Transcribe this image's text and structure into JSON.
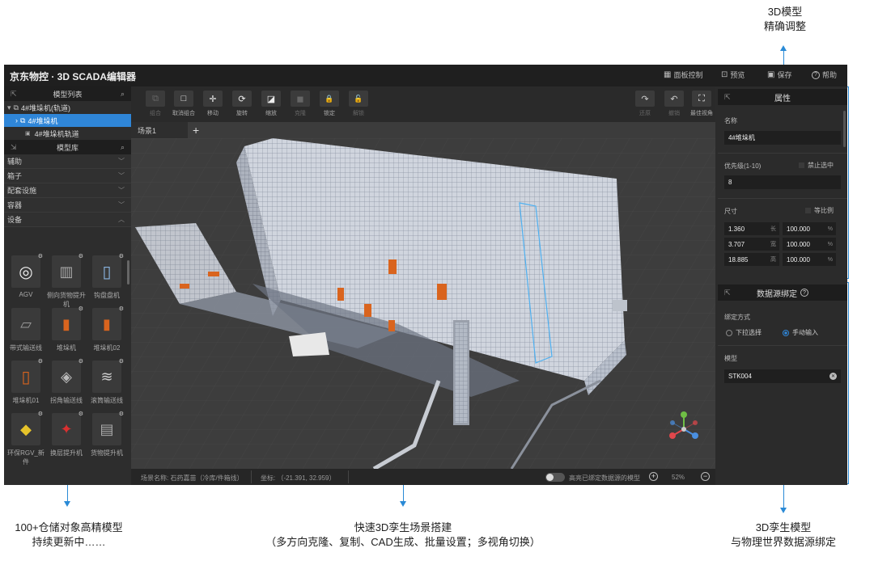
{
  "callouts": {
    "top_right_line1": "3D模型",
    "top_right_line2": "精确调整",
    "bottom_left_line1": "100+仓储对象高精模型",
    "bottom_left_line2": "持续更新中……",
    "bottom_center_line1": "快速3D孪生场景搭建",
    "bottom_center_line2": "（多方向克隆、复制、CAD生成、批量设置；多视角切换）",
    "bottom_right_line1": "3D孪生模型",
    "bottom_right_line2": "与物理世界数据源绑定"
  },
  "app": {
    "brand": "京东物控 · 3D SCADA编辑器",
    "top_menu": [
      {
        "icon": "panel-control-icon",
        "glyph": "▦",
        "label": "面板控制"
      },
      {
        "icon": "preview-icon",
        "glyph": "⊡",
        "label": "预览"
      },
      {
        "icon": "save-icon",
        "glyph": "▣",
        "label": "保存"
      },
      {
        "icon": "help-icon",
        "glyph": "?",
        "label": "帮助"
      }
    ]
  },
  "model_list": {
    "title": "模型列表",
    "tree": [
      {
        "label": "4#堆垛机(轨道)",
        "level": 0,
        "selected": false
      },
      {
        "label": "4#堆垛机",
        "level": 1,
        "selected": true
      },
      {
        "label": "4#堆垛机轨道",
        "level": 1,
        "selected": false
      }
    ]
  },
  "model_library": {
    "title": "模型库",
    "categories": [
      "辅助",
      "箱子",
      "配套设施",
      "容器",
      "设备"
    ],
    "items": [
      {
        "label": "AGV",
        "glyph": "◎"
      },
      {
        "label": "侧向货物提升机",
        "glyph": "▥"
      },
      {
        "label": "钩盘盘机",
        "glyph": "▯"
      },
      {
        "label": "带式输送线",
        "glyph": "▱"
      },
      {
        "label": "堆垛机",
        "glyph": "▮"
      },
      {
        "label": "堆垛机02",
        "glyph": "▮"
      },
      {
        "label": "堆垛机01",
        "glyph": "▯"
      },
      {
        "label": "拐角输送线",
        "glyph": "◈"
      },
      {
        "label": "滚筒输送线",
        "glyph": "≋"
      },
      {
        "label": "环保RGV_新件",
        "glyph": "◆"
      },
      {
        "label": "换层提升机",
        "glyph": "✦"
      },
      {
        "label": "货物提升机",
        "glyph": "▤"
      }
    ]
  },
  "toolbar": {
    "left_tools": [
      {
        "label": "组合",
        "glyph": "⧉",
        "enabled": false
      },
      {
        "label": "取消组合",
        "glyph": "□",
        "enabled": true
      },
      {
        "label": "移动",
        "glyph": "✛",
        "enabled": true
      },
      {
        "label": "旋转",
        "glyph": "⟳",
        "enabled": true
      },
      {
        "label": "缩放",
        "glyph": "◪",
        "enabled": true
      },
      {
        "label": "克隆",
        "glyph": "◼",
        "enabled": false
      },
      {
        "label": "锁定",
        "glyph": "🔒",
        "enabled": true
      },
      {
        "label": "解锁",
        "glyph": "🔓",
        "enabled": false
      }
    ],
    "right_tools": [
      {
        "label": "还原",
        "glyph": "↷",
        "enabled": false
      },
      {
        "label": "撤销",
        "glyph": "↶",
        "enabled": false
      },
      {
        "label": "最佳视角",
        "glyph": "⛶",
        "enabled": true
      }
    ]
  },
  "scene": {
    "tab": "场景1",
    "add": "+"
  },
  "statusbar": {
    "scene_name": "场景名称: 石药嘉苗（冷库/件箱线）",
    "coords": "坐标: （-21.391, 32.959）",
    "highlight_label": "高亮已绑定数据源的模型",
    "zoom": "52%",
    "zoom_in": "+",
    "zoom_out": "−"
  },
  "properties": {
    "title": "属性",
    "name_label": "名称",
    "name_value": "4#堆垛机",
    "priority_label": "优先级(1-10)",
    "disable_select_label": "禁止选中",
    "priority_value": "8",
    "size_label": "尺寸",
    "proportional_label": "等比例",
    "dims": [
      {
        "value": "1.360",
        "unit": "长",
        "pct": "100.000",
        "pct_unit": "%"
      },
      {
        "value": "3.707",
        "unit": "宽",
        "pct": "100.000",
        "pct_unit": "%"
      },
      {
        "value": "18.885",
        "unit": "高",
        "pct": "100.000",
        "pct_unit": "%"
      }
    ]
  },
  "datasource": {
    "title": "数据源绑定",
    "help": "?",
    "bind_mode_label": "绑定方式",
    "options": [
      {
        "label": "下拉选择",
        "selected": false
      },
      {
        "label": "手动输入",
        "selected": true
      }
    ],
    "model_label": "模型",
    "model_value": "STK004",
    "clear": "✕"
  },
  "colors": {
    "accent": "#2f86d8",
    "highlight_border": "#2a8ad6",
    "crane_orange": "#d9641e"
  }
}
